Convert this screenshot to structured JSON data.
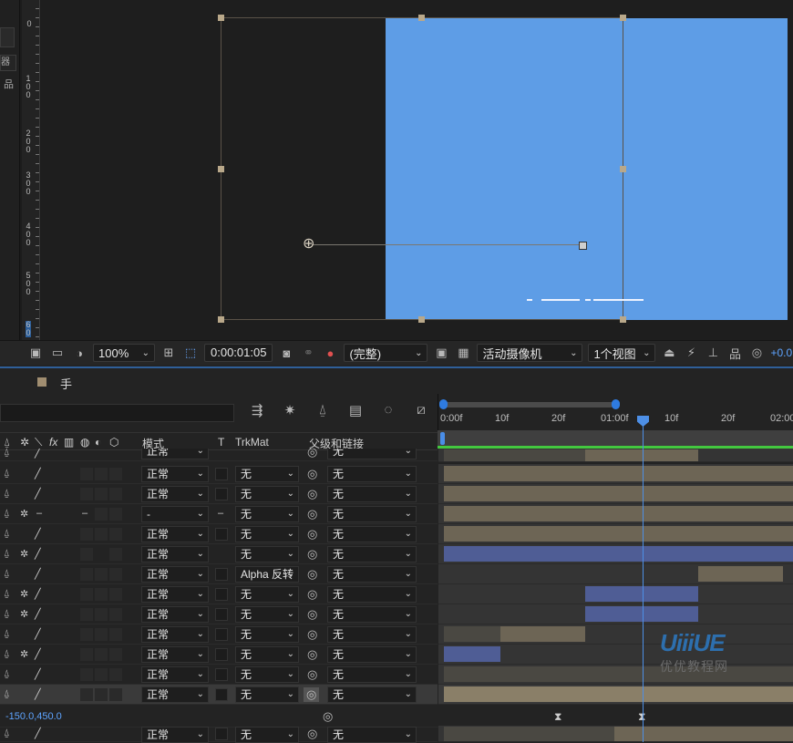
{
  "viewer": {
    "ruler_numbers": [
      "0",
      "1 0 0",
      "2 0 0",
      "3 0 0",
      "4 0 0",
      "5 0 0",
      "6 0"
    ],
    "left_tab_label": "器",
    "comp_color": "#5e9de6"
  },
  "viewer_toolbar": {
    "zoom": "100%",
    "timecode": "0:00:01:05",
    "resolution": "(完整)",
    "camera": "活动摄像机",
    "views": "1个视图",
    "exposure": "+0.0"
  },
  "timeline": {
    "comp_tab": "手",
    "columns": {
      "mode": "模式",
      "t": "T",
      "trkmat": "TrkMat",
      "parent": "父级和链接"
    },
    "time_labels": [
      "0:00f",
      "10f",
      "20f",
      "01:00f",
      "10f",
      "20f",
      "02:00"
    ],
    "layers": [
      {
        "mode": "正常",
        "trkmat": "",
        "parent": "无"
      },
      {
        "mode": "正常",
        "trkmat": "无",
        "parent": "无"
      },
      {
        "mode": "正常",
        "trkmat": "无",
        "parent": "无"
      },
      {
        "mode": "-",
        "trkmat": "无",
        "parent": "无"
      },
      {
        "mode": "正常",
        "trkmat": "无",
        "parent": "无"
      },
      {
        "mode": "正常",
        "trkmat": "无",
        "parent": "无"
      },
      {
        "mode": "正常",
        "trkmat": "Alpha 反转",
        "parent": "无"
      },
      {
        "mode": "正常",
        "trkmat": "无",
        "parent": "无"
      },
      {
        "mode": "正常",
        "trkmat": "无",
        "parent": "无"
      },
      {
        "mode": "正常",
        "trkmat": "无",
        "parent": "无"
      },
      {
        "mode": "正常",
        "trkmat": "无",
        "parent": "无"
      },
      {
        "mode": "正常",
        "trkmat": "无",
        "parent": "无"
      },
      {
        "mode": "正常",
        "trkmat": "无",
        "parent": "无"
      }
    ],
    "last_layer": {
      "mode": "正常",
      "trkmat": "无",
      "parent": "无"
    },
    "property_value": "-150.0,450.0"
  },
  "watermark": {
    "logo": "UiiiUE",
    "text": "优优教程网"
  },
  "colors": {
    "accent": "#4d8fe6",
    "green_bar": "#43c83f",
    "tan_bar": "#6d6555",
    "blue_bar": "#4f5d95"
  }
}
